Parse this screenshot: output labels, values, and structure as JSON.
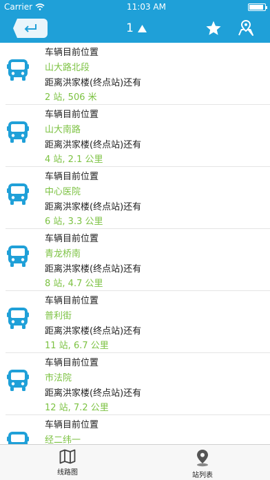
{
  "status": {
    "carrier": "Carrier",
    "time": "11:03 AM"
  },
  "header": {
    "count": "1"
  },
  "stops": [
    {
      "label": "车辆目前位置",
      "station": "山大路北段",
      "dist_label": "距离洪家楼(终点站)还有",
      "distance": "2 站, 506 米"
    },
    {
      "label": "车辆目前位置",
      "station": "山大南路",
      "dist_label": "距离洪家楼(终点站)还有",
      "distance": "4 站, 2.1 公里"
    },
    {
      "label": "车辆目前位置",
      "station": "中心医院",
      "dist_label": "距离洪家楼(终点站)还有",
      "distance": "6 站, 3.3 公里"
    },
    {
      "label": "车辆目前位置",
      "station": "青龙桥南",
      "dist_label": "距离洪家楼(终点站)还有",
      "distance": "8 站, 4.7 公里"
    },
    {
      "label": "车辆目前位置",
      "station": "普利街",
      "dist_label": "距离洪家楼(终点站)还有",
      "distance": "11 站, 6.7 公里"
    },
    {
      "label": "车辆目前位置",
      "station": "市法院",
      "dist_label": "距离洪家楼(终点站)还有",
      "distance": "12 站, 7.2 公里"
    },
    {
      "label": "车辆目前位置",
      "station": "经二纬一",
      "dist_label": "",
      "distance": ""
    }
  ],
  "tabs": [
    {
      "label": "线路图",
      "icon": "map-icon"
    },
    {
      "label": "站列表",
      "icon": "location-pin-icon"
    }
  ],
  "colors": {
    "brand": "#1fa0d8",
    "accent_green": "#7cc242"
  }
}
